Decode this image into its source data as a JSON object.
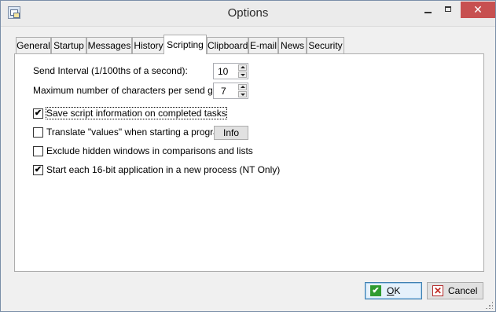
{
  "window": {
    "title": "Options"
  },
  "titlebar": {
    "minimize_icon": "minimize-icon",
    "maximize_icon": "maximize-icon",
    "close_glyph": "✕"
  },
  "tabs": [
    {
      "label": "General"
    },
    {
      "label": "Startup"
    },
    {
      "label": "Messages"
    },
    {
      "label": "History"
    },
    {
      "label": "Scripting",
      "active": true
    },
    {
      "label": "Clipboard"
    },
    {
      "label": "E-mail"
    },
    {
      "label": "News"
    },
    {
      "label": "Security"
    }
  ],
  "scripting": {
    "send_interval": {
      "label": "Send Interval (1/100ths of a second):",
      "value": "10"
    },
    "max_chars": {
      "label": "Maximum number of characters per send group:",
      "value": "7"
    },
    "options": [
      {
        "label": "Save script information on completed tasks",
        "checked": true,
        "check_glyph": "✔"
      },
      {
        "label": "Translate \"values\" when starting a program",
        "checked": false,
        "check_glyph": ""
      },
      {
        "label": "Exclude hidden windows in comparisons and lists",
        "checked": false,
        "check_glyph": ""
      },
      {
        "label": "Start each 16-bit application in a new process (NT Only)",
        "checked": true,
        "check_glyph": "✔"
      }
    ],
    "info_button": "Info"
  },
  "footer": {
    "ok_label": "OK",
    "ok_mnemonic": "O",
    "ok_rest": "K",
    "ok_icon_glyph": "✔",
    "cancel_label": "Cancel",
    "cancel_icon_glyph": "✕"
  },
  "colors": {
    "accent": "#3c7fb1",
    "close_red": "#c75050",
    "ok_green": "#2f9b2f",
    "cancel_red": "#c0271f"
  }
}
